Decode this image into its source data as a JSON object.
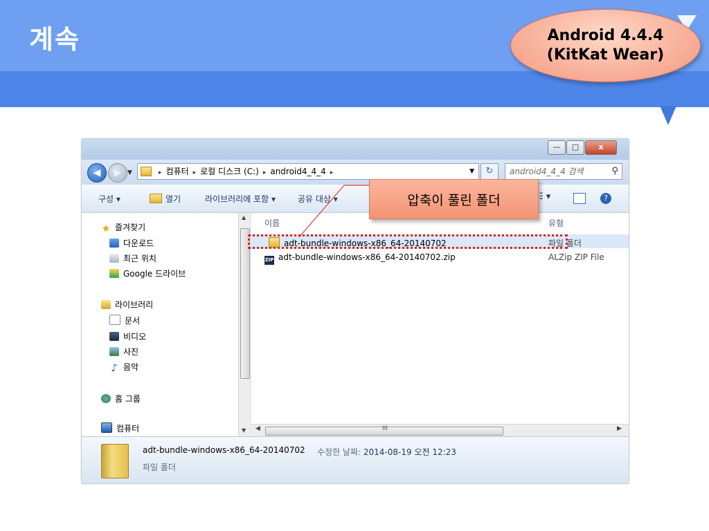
{
  "slide": {
    "title": "계속",
    "badge_line1": "Android 4.4.4",
    "badge_line2": "(KitKat Wear)",
    "callout": "압축이 풀린 폴더"
  },
  "window": {
    "controls": {
      "minimize": "—",
      "maximize": "□",
      "close": "x"
    },
    "address": {
      "crumbs": [
        "컴퓨터",
        "로컬 디스크 (C:)",
        "android4_4_4"
      ],
      "separator": "▸"
    },
    "search_placeholder": "android4_4_4 검색",
    "toolbar": {
      "organize": "구성 ▾",
      "open": "열기",
      "include_library": "라이브러리에 포함 ▾",
      "share": "공유 대상 ▾",
      "view": "☷ ▾"
    },
    "nav": {
      "favorites": "즐겨찾기",
      "downloads": "다운로드",
      "recent": "최근 위치",
      "google_drive": "Google 드라이브",
      "libraries": "라이브러리",
      "documents": "문서",
      "videos": "비디오",
      "pictures": "사진",
      "music": "음악",
      "homegroup": "홈 그룹",
      "computer": "컴퓨터"
    },
    "columns": {
      "name": "이름",
      "type": "유형"
    },
    "files": [
      {
        "name": "adt-bundle-windows-x86_64-20140702",
        "type": "파일 폴더",
        "icon": "folder-icon",
        "selected": true
      },
      {
        "name": "adt-bundle-windows-x86_64-20140702.zip",
        "type": "ALZip ZIP File",
        "icon": "zip-icon",
        "selected": false
      }
    ],
    "zip_icon_label": "ZIP",
    "scrollbar_grip": "III",
    "details": {
      "name": "adt-bundle-windows-x86_64-20140702",
      "modified_label": "수정한 날짜:",
      "modified_value": "2014-08-19 오전 12:23",
      "type": "파일 폴더"
    }
  }
}
